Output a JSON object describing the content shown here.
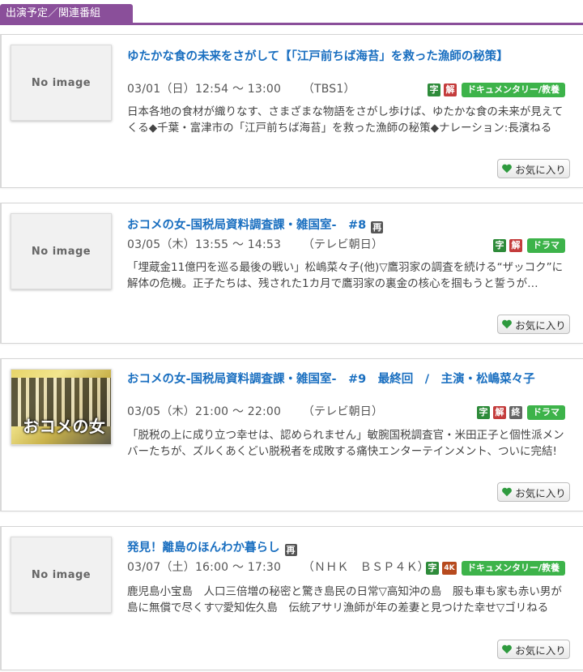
{
  "header": {
    "tab_label": "出演予定／関連番組"
  },
  "programs": [
    {
      "thumb": "No image",
      "title": "ゆたかな食の未来をさがして【「江戸前ちば海苔」を救った漁師の秘策】",
      "rebroadcast": "",
      "date": "03/01（日）12:54 ～ 13:00",
      "channel": "（TBS1）",
      "badges": [
        "字",
        "解"
      ],
      "genre": "ドキュメンタリー/教養",
      "description": "日本各地の食材が織りなす、さまざまな物語をさがし歩けば、ゆたかな食の未来が見えてくる◆千葉・富津市の「江戸前ちば海苔」を救った漁師の秘策◆ナレーション:長濱ねる",
      "fav_label": "お気に入り"
    },
    {
      "thumb": "No image",
      "title": "おコメの女-国税局資料調査課・雑国室-　#8",
      "rebroadcast": "再",
      "date": "03/05（木）13:55 ～ 14:53",
      "channel": "（テレビ朝日）",
      "badges": [
        "字",
        "解"
      ],
      "genre": "ドラマ",
      "description": "「埋蔵金11億円を巡る最後の戦い」松嶋菜々子(他)▽鷹羽家の調査を続ける“ザッコク”に解体の危機。正子たちは、残された1カ月で鷹羽家の裏金の核心を掴もうと誓うが…",
      "fav_label": "お気に入り"
    },
    {
      "thumb": "おコメの女",
      "title": "おコメの女-国税局資料調査課・雑国室-　#9　最終回　/　主演・松嶋菜々子",
      "rebroadcast": "",
      "date": "03/05（木）21:00 ～ 22:00",
      "channel": "（テレビ朝日）",
      "badges": [
        "字",
        "解",
        "終"
      ],
      "genre": "ドラマ",
      "description": "「脱税の上に成り立つ幸せは、認められません」敏腕国税調査官・米田正子と個性派メンバーたちが、ズルくあくどい脱税者を成敗する痛快エンターテインメント、ついに完結!",
      "fav_label": "お気に入り"
    },
    {
      "thumb": "No image",
      "title": "発見！離島のほんわか暮らし",
      "rebroadcast": "再",
      "date": "03/07（土）16:00 ～ 17:30",
      "channel": "（ＮＨＫ　ＢＳＰ４Ｋ）",
      "badges": [
        "字",
        "4K"
      ],
      "genre": "ドキュメンタリー/教養",
      "description": "鹿児島小宝島　人口三倍増の秘密と驚き島民の日常▽高知沖の島　服も車も家も赤い男が島に無償で尽くす▽愛知佐久島　伝統アサリ漁師が年の差妻と見つけた幸せ▽ゴリねる",
      "fav_label": "お気に入り"
    }
  ]
}
